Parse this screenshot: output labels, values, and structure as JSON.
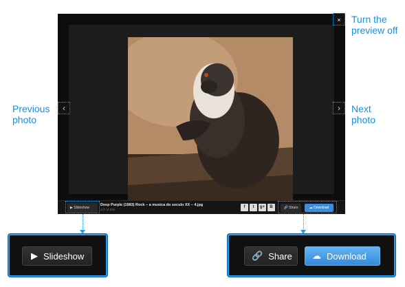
{
  "callouts": {
    "close": [
      "Turn the",
      "preview off"
    ],
    "previous": [
      "Previous",
      "photo"
    ],
    "next": [
      "Next",
      "photo"
    ]
  },
  "viewer": {
    "close_glyph": "×",
    "prev_glyph": "‹",
    "next_glyph": "›",
    "caption": "Deep Purple (1983) Rock – a musica do seculo XX – 4.jpg",
    "counter": "137 of 693",
    "slideshow_label": "Slideshow",
    "share_label": "Share",
    "download_label": "Download",
    "social": [
      {
        "icon": "facebook-icon",
        "glyph": "f"
      },
      {
        "icon": "twitter-icon",
        "glyph": "t"
      },
      {
        "icon": "google-plus-icon",
        "glyph": "g+"
      },
      {
        "icon": "blogger-icon",
        "glyph": "B"
      }
    ]
  },
  "zoom": {
    "slideshow_label": "Slideshow",
    "share_label": "Share",
    "download_label": "Download"
  },
  "colors": {
    "accent": "#2a9be6",
    "download": "#3a8ee0"
  }
}
